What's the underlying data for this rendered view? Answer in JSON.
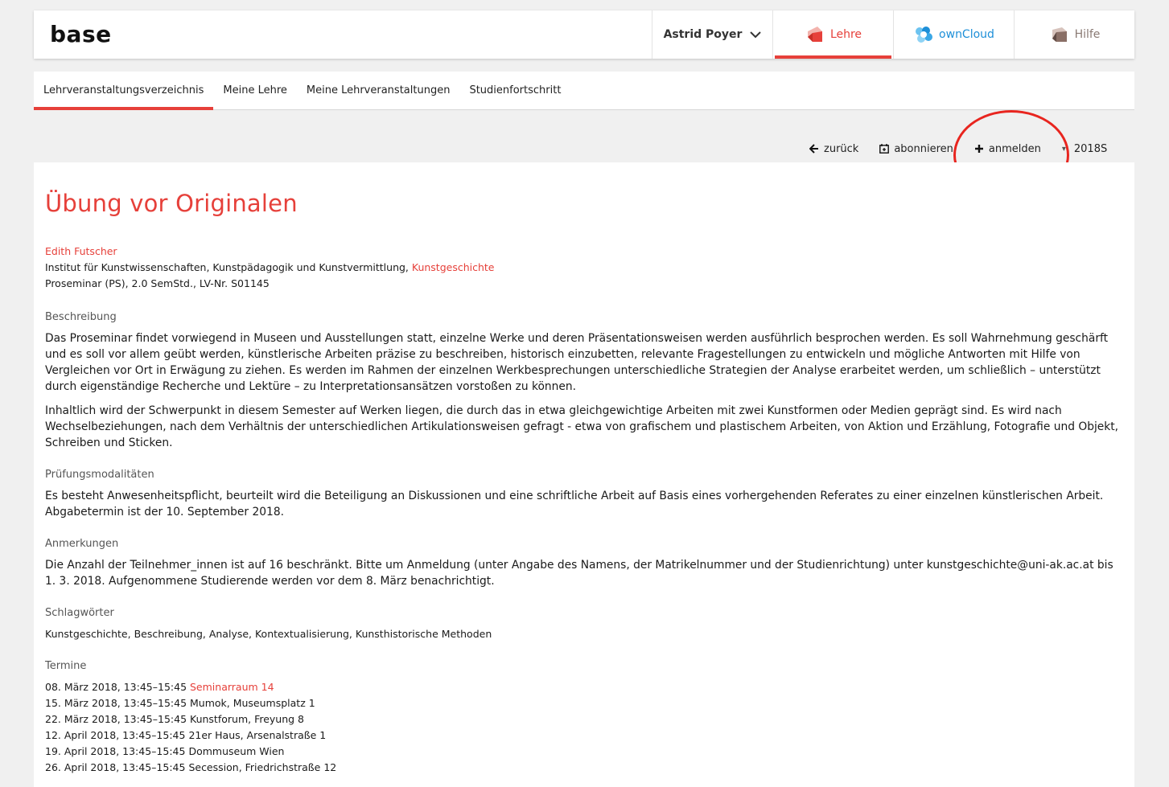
{
  "header": {
    "logo": "base",
    "user_name": "Astrid Poyer",
    "lehre_label": "Lehre",
    "owncloud_label": "ownCloud",
    "hilfe_label": "Hilfe"
  },
  "nav": {
    "tabs": [
      {
        "label": "Lehrveranstaltungsverzeichnis"
      },
      {
        "label": "Meine Lehre"
      },
      {
        "label": "Meine Lehrveranstaltungen"
      },
      {
        "label": "Studienfortschritt"
      }
    ]
  },
  "toolbar": {
    "back_label": "zurück",
    "subscribe_label": "abonnieren",
    "register_label": "anmelden",
    "semester": "2018S"
  },
  "course": {
    "title": "Übung vor Originalen",
    "lecturer": "Edith Futscher",
    "institute": "Institut für Kunstwissenschaften, Kunstpädagogik und Kunstvermittlung, ",
    "department": "Kunstgeschichte",
    "type_info": "Proseminar (PS), 2.0 SemStd., LV-Nr. S01145",
    "sections": {
      "description_heading": "Beschreibung",
      "description_p1": "Das Proseminar findet vorwiegend in Museen und Ausstellungen statt, einzelne Werke und deren Präsentationsweisen werden ausführlich besprochen werden. Es soll Wahrnehmung geschärft und es soll vor allem geübt werden, künstlerische Arbeiten präzise zu beschreiben, historisch einzubetten, relevante Fragestellungen zu entwickeln und mögliche Antworten mit Hilfe von Vergleichen vor Ort in Erwägung zu ziehen. Es werden im Rahmen der einzelnen Werkbesprechungen unterschiedliche Strategien der Analyse erarbeitet werden, um schließlich – unterstützt durch eigenständige Recherche und Lektüre – zu Interpretationsansätzen vorstoßen zu können.",
      "description_p2": "Inhaltlich wird der Schwerpunkt in diesem Semester auf Werken liegen, die durch das in etwa gleichgewichtige Arbeiten mit zwei Kunstformen oder Medien geprägt sind. Es wird nach Wechselbeziehungen, nach dem Verhältnis der unterschiedlichen Artikulationsweisen gefragt - etwa von grafischem und plastischem Arbeiten, von Aktion und Erzählung, Fotografie und Objekt, Schreiben und Sticken.",
      "exam_heading": "Prüfungsmodalitäten",
      "exam_text": "Es besteht Anwesenheitspflicht, beurteilt wird die Beteiligung an Diskussionen und eine schriftliche Arbeit auf Basis eines vorhergehenden Referates zu einer einzelnen künstlerischen Arbeit. Abgabetermin ist der 10. September 2018.",
      "notes_heading": "Anmerkungen",
      "notes_text": "Die Anzahl der Teilnehmer_innen ist auf 16 beschränkt. Bitte um Anmeldung (unter Angabe des Namens, der Matrikelnummer und der Studienrichtung) unter kunstgeschichte@uni-ak.ac.at bis 1. 3. 2018. Aufgenommene Studierende werden vor dem 8. März benachrichtigt.",
      "keywords_heading": "Schlagwörter",
      "keywords_text": "Kunstgeschichte, Beschreibung, Analyse, Kontextualisierung, Kunsthistorische Methoden",
      "dates_heading": "Termine"
    },
    "dates": [
      {
        "when": "08. März 2018, 13:45–15:45 ",
        "where": "Seminarraum 14",
        "link": true
      },
      {
        "when": "15. März 2018, 13:45–15:45 ",
        "where": "Mumok, Museumsplatz 1",
        "link": false
      },
      {
        "when": "22. März 2018, 13:45–15:45 ",
        "where": "Kunstforum, Freyung 8",
        "link": false
      },
      {
        "when": "12. April 2018, 13:45–15:45 ",
        "where": "21er Haus, Arsenalstraße 1",
        "link": false
      },
      {
        "when": "19. April 2018, 13:45–15:45 ",
        "where": "Dommuseum Wien",
        "link": false
      },
      {
        "when": "26. April 2018, 13:45–15:45 ",
        "where": "Secession, Friedrichstraße 12",
        "link": false
      }
    ]
  },
  "colors": {
    "accent": "#e6403a",
    "owncloud": "#1d8fd8",
    "annotation": "#e8251f"
  }
}
